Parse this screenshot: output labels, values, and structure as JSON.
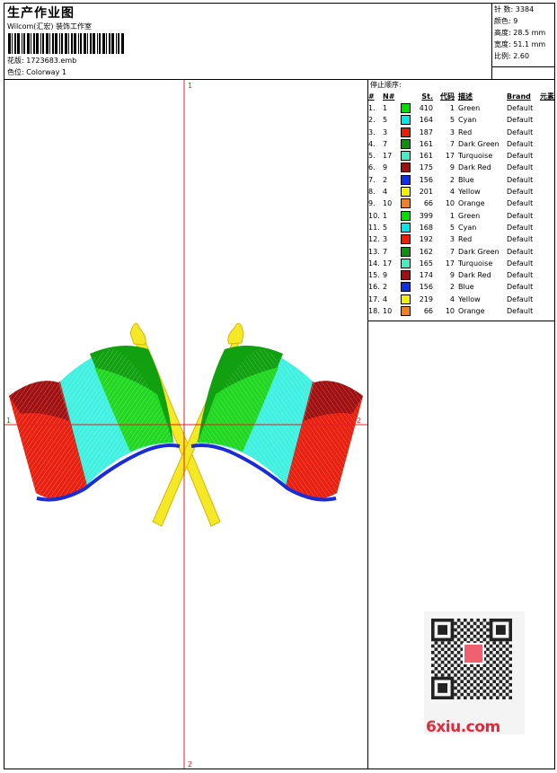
{
  "header": {
    "title": "生产作业图",
    "company": "Wilcom(汇宏) 装饰工作室",
    "design_file_label": "花版:",
    "design_file": "1723683.emb",
    "colorway_label": "色位:",
    "colorway": "Colorway 1"
  },
  "stats": {
    "stitches_label": "针 数:",
    "stitches": "3384",
    "colors_label": "颜色:",
    "colors": "9",
    "height_label": "高度:",
    "height": "28.5 mm",
    "width_label": "宽度:",
    "width": "51.1 mm",
    "scale_label": "比例:",
    "scale": "2.60"
  },
  "canvas": {
    "axis_top": "1",
    "axis_left": "1",
    "axis_right": "2",
    "axis_bottom": "2"
  },
  "sequence": {
    "title": "停止顺序:",
    "headers": [
      "#",
      "N#",
      "St.",
      "代码",
      "描述",
      "Brand",
      "元素"
    ],
    "rows": [
      {
        "idx": "1.",
        "n": "1",
        "st": "410",
        "code": "1",
        "desc": "Green",
        "brand": "Default",
        "color": "#00e000"
      },
      {
        "idx": "2.",
        "n": "5",
        "st": "164",
        "code": "5",
        "desc": "Cyan",
        "brand": "Default",
        "color": "#00e8e8"
      },
      {
        "idx": "3.",
        "n": "3",
        "st": "187",
        "code": "3",
        "desc": "Red",
        "brand": "Default",
        "color": "#ee1c00"
      },
      {
        "idx": "4.",
        "n": "7",
        "st": "161",
        "code": "7",
        "desc": "Dark Green",
        "brand": "Default",
        "color": "#109010"
      },
      {
        "idx": "5.",
        "n": "17",
        "st": "161",
        "code": "17",
        "desc": "Turquoise",
        "brand": "Default",
        "color": "#40f0c0"
      },
      {
        "idx": "6.",
        "n": "9",
        "st": "175",
        "code": "9",
        "desc": "Dark Red",
        "brand": "Default",
        "color": "#a01010"
      },
      {
        "idx": "7.",
        "n": "2",
        "st": "156",
        "code": "2",
        "desc": "Blue",
        "brand": "Default",
        "color": "#1030e8"
      },
      {
        "idx": "8.",
        "n": "4",
        "st": "201",
        "code": "4",
        "desc": "Yellow",
        "brand": "Default",
        "color": "#f0f000"
      },
      {
        "idx": "9.",
        "n": "10",
        "st": "66",
        "code": "10",
        "desc": "Orange",
        "brand": "Default",
        "color": "#f08020"
      },
      {
        "idx": "10.",
        "n": "1",
        "st": "399",
        "code": "1",
        "desc": "Green",
        "brand": "Default",
        "color": "#00e000"
      },
      {
        "idx": "11.",
        "n": "5",
        "st": "168",
        "code": "5",
        "desc": "Cyan",
        "brand": "Default",
        "color": "#00e8e8"
      },
      {
        "idx": "12.",
        "n": "3",
        "st": "192",
        "code": "3",
        "desc": "Red",
        "brand": "Default",
        "color": "#ee1c00"
      },
      {
        "idx": "13.",
        "n": "7",
        "st": "162",
        "code": "7",
        "desc": "Dark Green",
        "brand": "Default",
        "color": "#109010"
      },
      {
        "idx": "14.",
        "n": "17",
        "st": "165",
        "code": "17",
        "desc": "Turquoise",
        "brand": "Default",
        "color": "#40f0c0"
      },
      {
        "idx": "15.",
        "n": "9",
        "st": "174",
        "code": "9",
        "desc": "Dark Red",
        "brand": "Default",
        "color": "#a01010"
      },
      {
        "idx": "16.",
        "n": "2",
        "st": "156",
        "code": "2",
        "desc": "Blue",
        "brand": "Default",
        "color": "#1030e8"
      },
      {
        "idx": "17.",
        "n": "4",
        "st": "219",
        "code": "4",
        "desc": "Yellow",
        "brand": "Default",
        "color": "#f0f000"
      },
      {
        "idx": "18.",
        "n": "10",
        "st": "66",
        "code": "10",
        "desc": "Orange",
        "brand": "Default",
        "color": "#f08020"
      }
    ]
  },
  "watermark": {
    "site": "6xiu.com"
  }
}
